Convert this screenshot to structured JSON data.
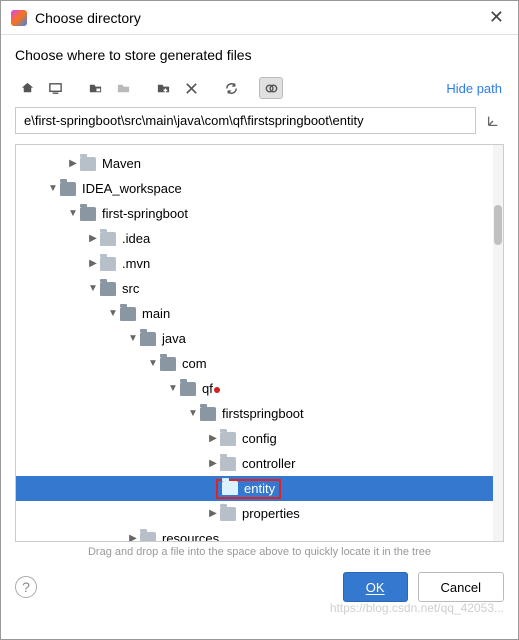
{
  "title": "Choose directory",
  "subtitle": "Choose where to store generated files",
  "hide_path": "Hide path",
  "path_value": "e\\first-springboot\\src\\main\\java\\com\\qf\\firstspringboot\\entity",
  "tree": [
    {
      "indent": 50,
      "arrow": "right",
      "icon": "folder",
      "label": "Maven"
    },
    {
      "indent": 30,
      "arrow": "down",
      "icon": "folder-open",
      "label": "IDEA_workspace"
    },
    {
      "indent": 50,
      "arrow": "down",
      "icon": "folder-open",
      "label": "first-springboot"
    },
    {
      "indent": 70,
      "arrow": "right",
      "icon": "folder",
      "label": ".idea"
    },
    {
      "indent": 70,
      "arrow": "right",
      "icon": "folder",
      "label": ".mvn"
    },
    {
      "indent": 70,
      "arrow": "down",
      "icon": "folder-open",
      "label": "src"
    },
    {
      "indent": 90,
      "arrow": "down",
      "icon": "folder-open",
      "label": "main"
    },
    {
      "indent": 110,
      "arrow": "down",
      "icon": "folder-open",
      "label": "java"
    },
    {
      "indent": 130,
      "arrow": "down",
      "icon": "folder-open",
      "label": "com"
    },
    {
      "indent": 150,
      "arrow": "down",
      "icon": "folder-open",
      "label": "qf",
      "reddot": true
    },
    {
      "indent": 170,
      "arrow": "down",
      "icon": "folder-open",
      "label": "firstspringboot"
    },
    {
      "indent": 190,
      "arrow": "right",
      "icon": "folder",
      "label": "config"
    },
    {
      "indent": 190,
      "arrow": "right",
      "icon": "folder",
      "label": "controller"
    },
    {
      "indent": 190,
      "arrow": "none",
      "icon": "folder-open",
      "label": "entity",
      "selected": true,
      "redbox": true
    },
    {
      "indent": 190,
      "arrow": "right",
      "icon": "folder",
      "label": "properties"
    },
    {
      "indent": 110,
      "arrow": "right",
      "icon": "folder",
      "label": "resources"
    }
  ],
  "hint": "Drag and drop a file into the space above to quickly locate it in the tree",
  "buttons": {
    "ok": "OK",
    "cancel": "Cancel"
  },
  "watermark": "https://blog.csdn.net/qq_42053..."
}
